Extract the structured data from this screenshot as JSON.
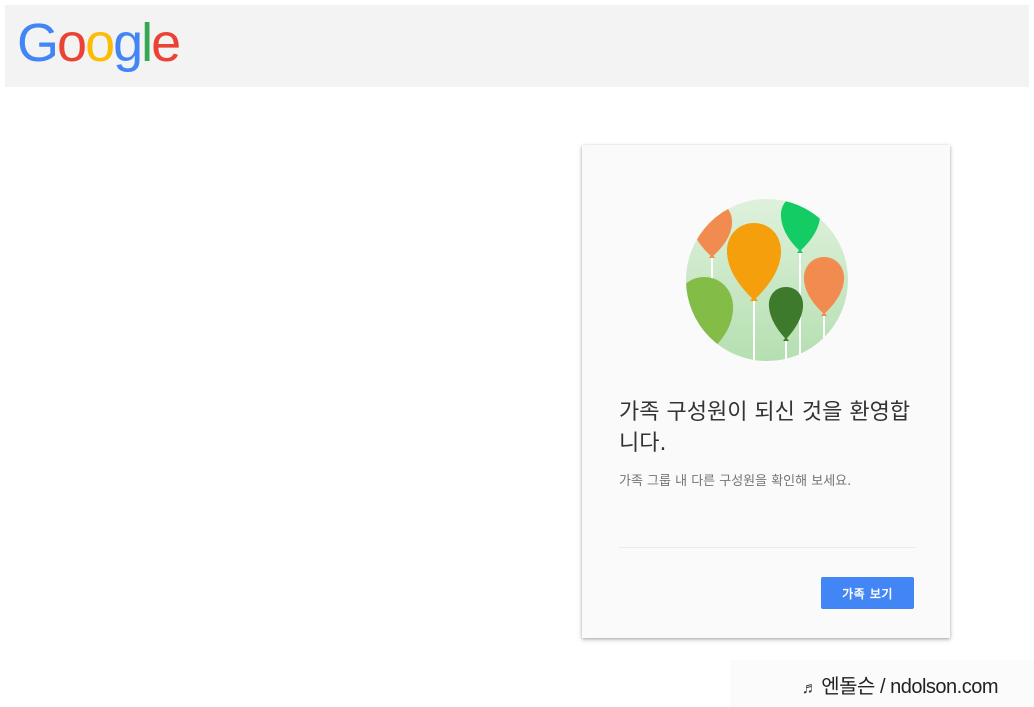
{
  "header": {
    "logo_letters": [
      "G",
      "o",
      "o",
      "g",
      "l",
      "e"
    ],
    "logo_colors": [
      "#4285F4",
      "#EA4335",
      "#FBBC05",
      "#4285F4",
      "#34A853",
      "#EA4335"
    ]
  },
  "card": {
    "title": "가족 구성원이 되신 것을 환영합니다.",
    "subtitle": "가족 그룹 내 다른 구성원을 확인해 보세요.",
    "button_label": "가족 보기",
    "illustration_icon": "balloons-icon",
    "colors": {
      "button": "#4285f4",
      "circle": "#d3ecd1",
      "balloon_orange": "#f28b50",
      "balloon_amber": "#f59f0c",
      "balloon_green": "#13cc63",
      "balloon_lightgreen": "#84bc48",
      "balloon_darkgreen": "#3e7a2b"
    }
  },
  "watermark": {
    "text": "엔돌슨 / ndolson.com",
    "icon": "music-note-icon"
  }
}
